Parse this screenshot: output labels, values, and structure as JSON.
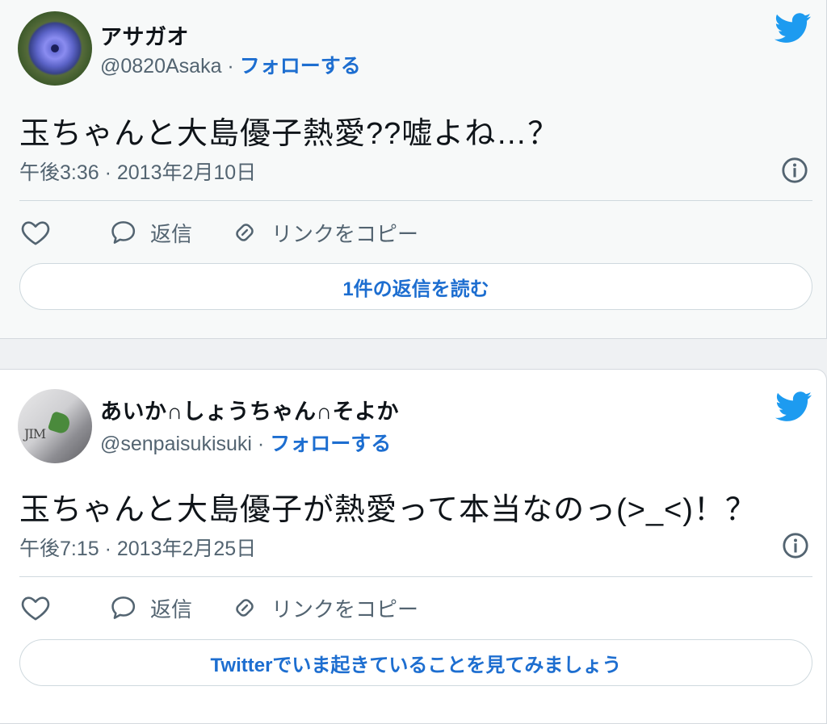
{
  "tweets": [
    {
      "display_name": "アサガオ",
      "handle": "@0820Asaka",
      "separator": " · ",
      "follow_label": "フォローする",
      "text": "玉ちゃんと大島優子熱愛??嘘よね…？",
      "timestamp": "午後3:36 · 2013年2月10日",
      "actions": {
        "reply_label": "返信",
        "copy_link_label": "リンクをコピー"
      },
      "footer_button": "1件の返信を読む"
    },
    {
      "display_name": "あいか∩しょうちゃん∩そよか",
      "handle": "@senpaisukisuki",
      "separator": " · ",
      "follow_label": "フォローする",
      "text": "玉ちゃんと大島優子が熱愛って本当なのっ(>_<)！？",
      "timestamp": "午後7:15 · 2013年2月25日",
      "actions": {
        "reply_label": "返信",
        "copy_link_label": "リンクをコピー"
      },
      "footer_button": "Twitterでいま起きていることを見てみましょう"
    }
  ],
  "avatar_letters": "JIM",
  "icons": [
    "twitter-bird-icon",
    "info-icon",
    "heart-icon",
    "reply-bubble-icon",
    "link-icon"
  ],
  "colors": {
    "accent": "#1d6ed0",
    "twitter_blue": "#1d9bf0",
    "muted_text": "#536471",
    "border": "#cfd9de",
    "card1_bg": "#f7f9f9",
    "card2_bg": "#ffffff",
    "page_bg": "#eff1f3"
  }
}
